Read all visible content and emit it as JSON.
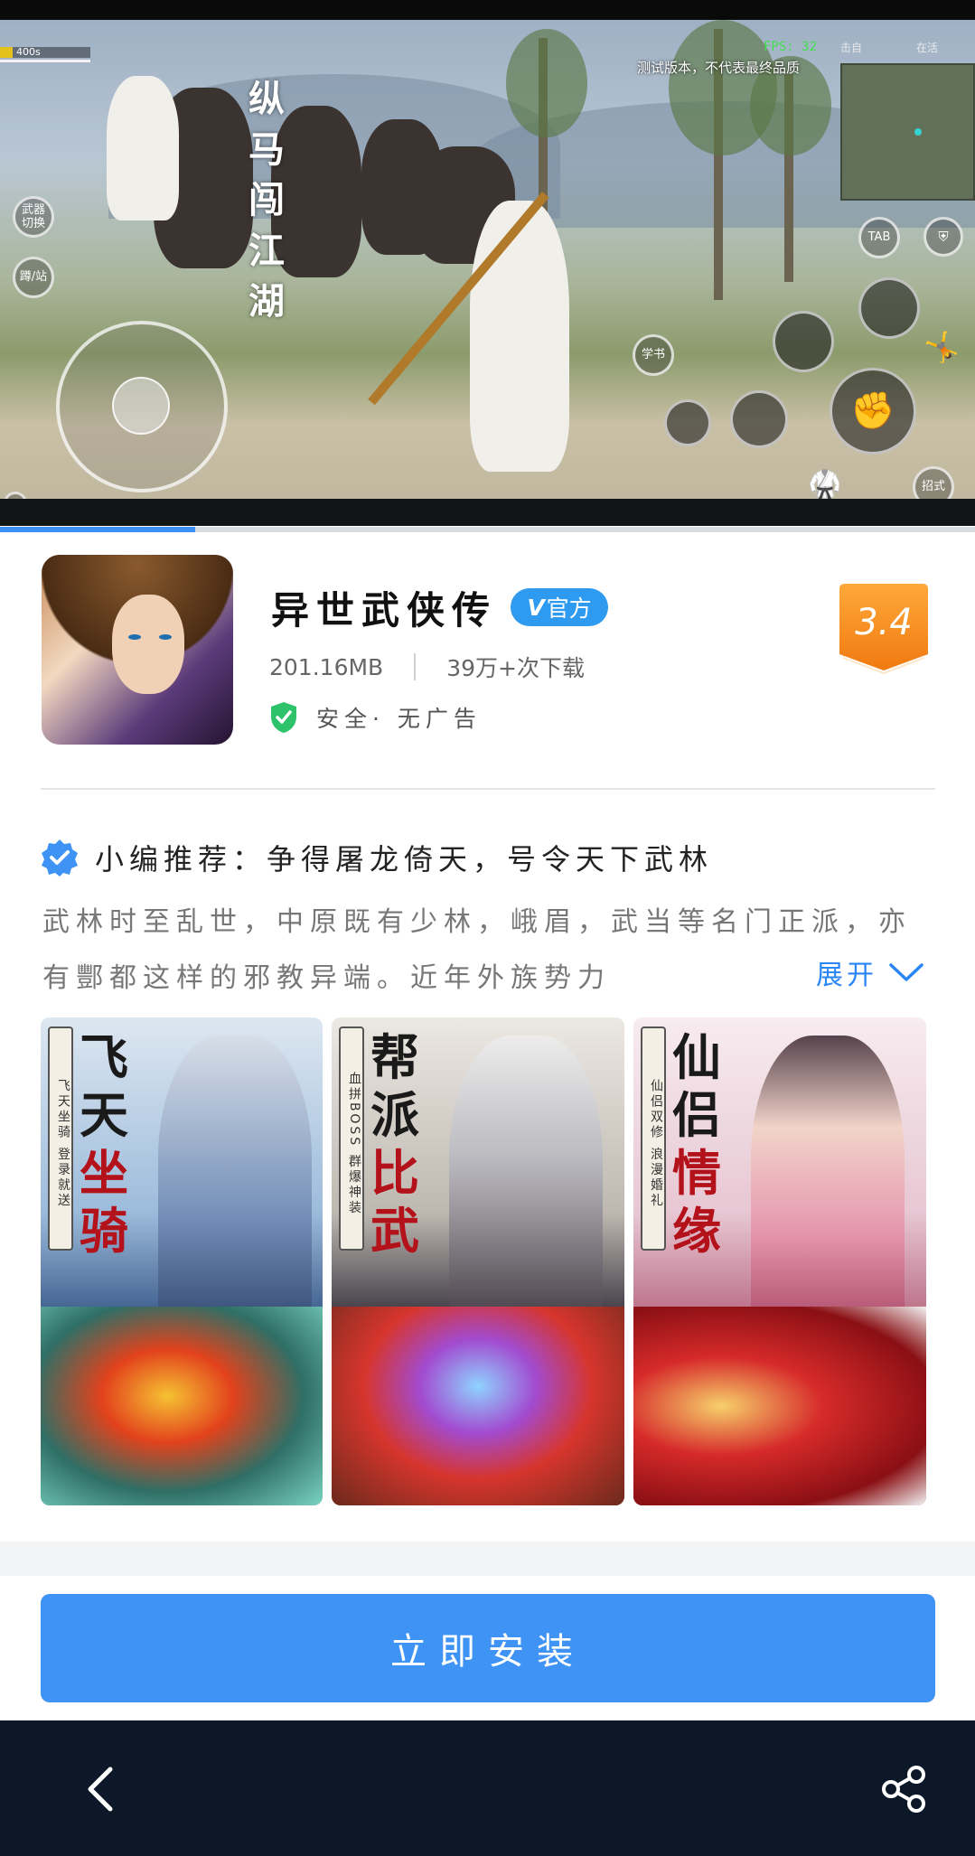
{
  "video": {
    "calligraphy": "纵\n马\n闯\n江\n湖",
    "hp_label": "400s",
    "fps": "FPS: 32",
    "top_left_label": "击自",
    "top_right_label": "在活",
    "test_notice": "测试版本，不代表最终品质",
    "hud": {
      "weapon_switch": "武器\n切换",
      "crouch_stand": "蹲/站",
      "tab": "TAB",
      "learn_book": "学书",
      "skills": "招式"
    },
    "playback_progress": 0.2
  },
  "app": {
    "title": "异世武侠传",
    "official_badge": "官方",
    "official_badge_mark": "V",
    "size": "201.16MB",
    "downloads": "39万+次下载",
    "safety": "安全·   无广告",
    "score": "3.4"
  },
  "recommend": {
    "headline": "小编推荐：争得屠龙倚天，号令天下武林",
    "description": "武林时至乱世，中原既有少林，峨眉，武当等名门正派，亦有酆都这样的邪教异端。近年外族势力",
    "expand_label": "展开"
  },
  "screenshots": [
    {
      "plaque": "飞天坐骑 登录就送",
      "title_top": "飞天",
      "title_bottom": "坐骑"
    },
    {
      "plaque": "血拼BOSS 群爆神装",
      "title_top": "帮派",
      "title_bottom": "比武"
    },
    {
      "plaque": "仙侣双修 浪漫婚礼",
      "title_top": "仙侣",
      "title_bottom": "情缘"
    }
  ],
  "install": {
    "label": "立即安装"
  },
  "colors": {
    "accent": "#3e93f5",
    "official_badge": "#2f9bf0",
    "score_badge": "#f7931e",
    "bottom_bar": "#0c1828",
    "safe_green": "#2ec26b"
  }
}
